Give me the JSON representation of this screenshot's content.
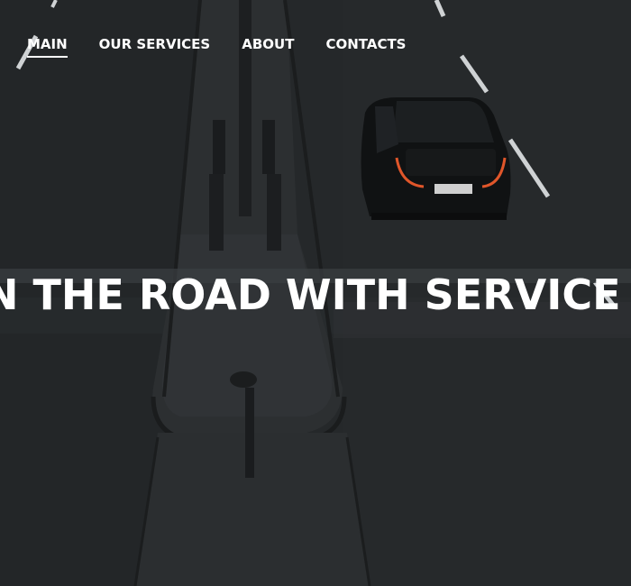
{
  "nav": {
    "items": [
      {
        "label": "MAIN",
        "active": true
      },
      {
        "label": "OUR SERVICES",
        "active": false
      },
      {
        "label": "ABOUT",
        "active": false
      },
      {
        "label": "CONTACTS",
        "active": false
      }
    ]
  },
  "hero": {
    "headline": "N THE ROAD WITH SERVICE YO",
    "background": "dark-road-with-car-photo"
  },
  "colors": {
    "text": "#ffffff",
    "asphalt": "#25282a",
    "lane_marking": "#cfd2d4",
    "tail_light": "#e0562a"
  }
}
